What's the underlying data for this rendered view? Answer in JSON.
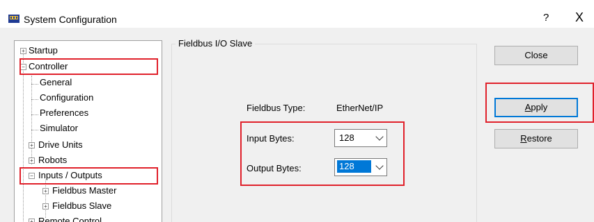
{
  "window": {
    "title": "System Configuration",
    "help_label": "?",
    "close_label": "X"
  },
  "tree": {
    "startup": "Startup",
    "controller": "Controller",
    "general": "General",
    "configuration": "Configuration",
    "preferences": "Preferences",
    "simulator": "Simulator",
    "drive_units": "Drive Units",
    "robots": "Robots",
    "inputs_outputs": "Inputs / Outputs",
    "fieldbus_master": "Fieldbus Master",
    "fieldbus_slave": "Fieldbus Slave",
    "remote_control": "Remote Control"
  },
  "panel": {
    "group_title": "Fieldbus I/O Slave",
    "fieldbus_type_label": "Fieldbus Type:",
    "fieldbus_type_value": "EtherNet/IP",
    "input_bytes_label": "Input Bytes:",
    "input_bytes_value": "128",
    "output_bytes_label": "Output Bytes:",
    "output_bytes_value": "128"
  },
  "buttons": {
    "close": "Close",
    "apply_first": "A",
    "apply_rest": "pply",
    "restore_first": "R",
    "restore_rest": "estore"
  },
  "colors": {
    "highlight": "#e0202a",
    "selection": "#0078d7"
  }
}
